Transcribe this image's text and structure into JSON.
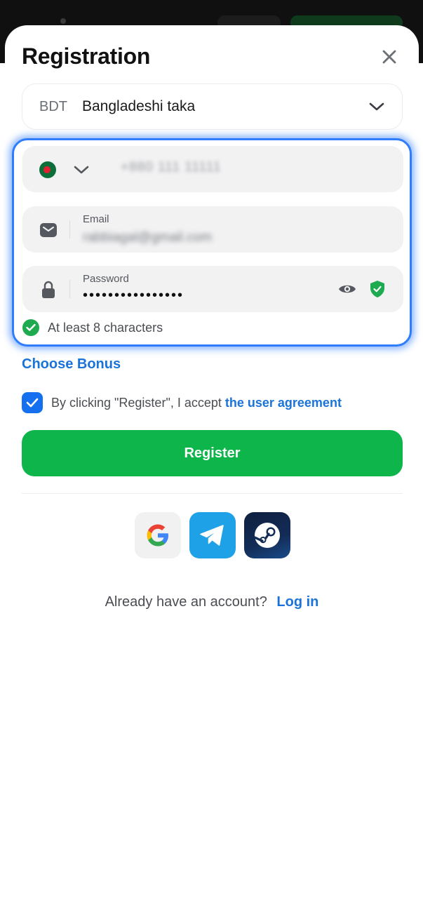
{
  "dialog": {
    "title": "Registration"
  },
  "currency": {
    "code": "BDT",
    "name": "Bangladeshi taka"
  },
  "phone": {
    "value": "+880 111 11111"
  },
  "email": {
    "label": "Email",
    "value": "rabbiagal@gmail.com"
  },
  "password": {
    "label": "Password",
    "value": "••••••••••••••••",
    "hint": "At least 8 characters"
  },
  "bonus": {
    "label": "Choose Bonus"
  },
  "agreement": {
    "text": "By clicking \"Register\", I accept",
    "link": "the user agreement",
    "checked": true
  },
  "register": {
    "label": "Register"
  },
  "social": {
    "providers": [
      "google-icon",
      "telegram-icon",
      "steam-icon"
    ]
  },
  "login": {
    "prompt": "Already have an account?",
    "link": "Log in"
  },
  "colors": {
    "accent_blue": "#1a73d9",
    "focus_border": "#2f7dfc",
    "register_green": "#0eb54a",
    "success_green": "#1eaa4f"
  }
}
